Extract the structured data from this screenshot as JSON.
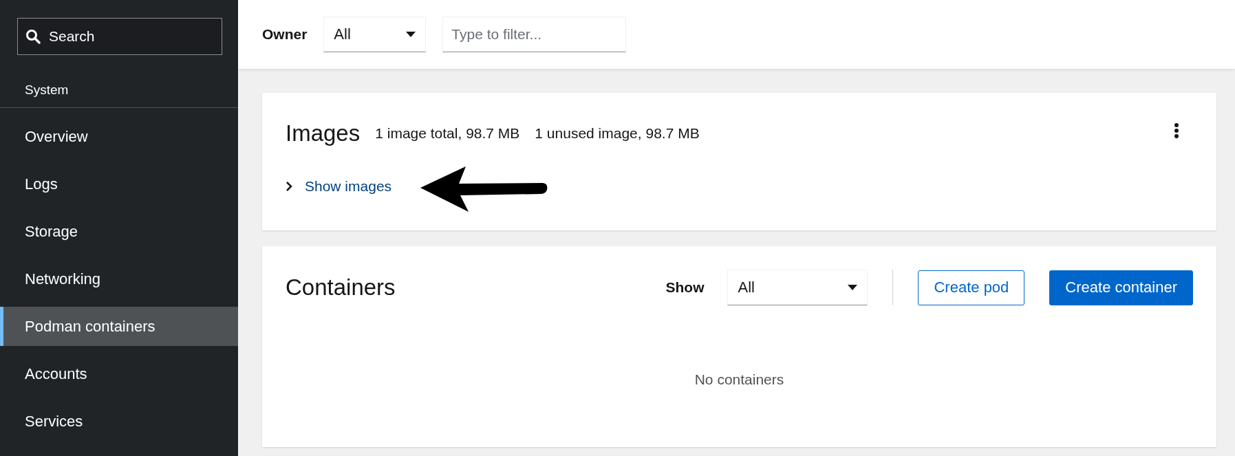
{
  "sidebar": {
    "search": {
      "placeholder": "Search"
    },
    "section": "System",
    "items": [
      {
        "label": "Overview",
        "selected": false
      },
      {
        "label": "Logs",
        "selected": false
      },
      {
        "label": "Storage",
        "selected": false
      },
      {
        "label": "Networking",
        "selected": false
      },
      {
        "label": "Podman containers",
        "selected": true
      },
      {
        "label": "Accounts",
        "selected": false
      },
      {
        "label": "Services",
        "selected": false
      }
    ]
  },
  "toolbar": {
    "owner_label": "Owner",
    "owner_select": "All",
    "filter": {
      "placeholder": "Type to filter..."
    }
  },
  "images": {
    "title": "Images",
    "stats": [
      "1 image total, 98.7 MB",
      "1 unused image, 98.7 MB"
    ],
    "toggle": {
      "label": "Show images",
      "expanded": false
    }
  },
  "containers": {
    "title": "Containers",
    "show_label": "Show",
    "show_select": "All",
    "buttons": [
      {
        "label": "Create pod",
        "kind": "secondary"
      },
      {
        "label": "Create container",
        "kind": "primary"
      }
    ],
    "empty": "No containers"
  }
}
